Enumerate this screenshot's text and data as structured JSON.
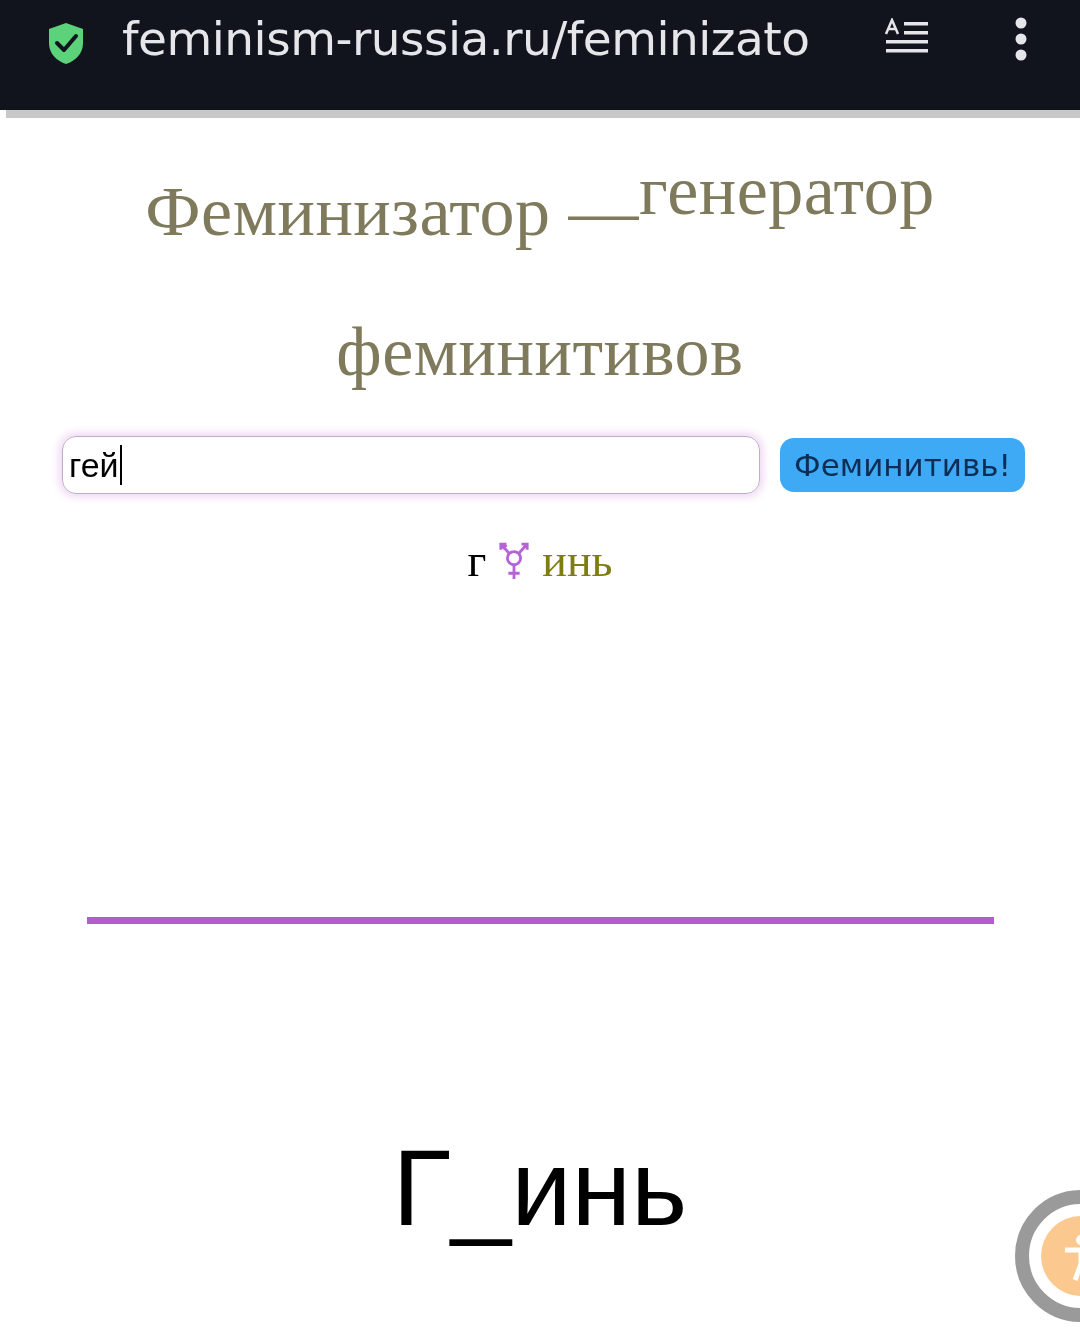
{
  "browser_bar": {
    "url": "feminism-russia.ru/feminizato"
  },
  "title": "Феминизатор —$^{генератор}$ феминитивов",
  "form": {
    "value": "гей",
    "button": "Феминитивь!"
  },
  "result": {
    "prefix": "г",
    "suffix": "инь"
  },
  "big_result": "Г_инь"
}
